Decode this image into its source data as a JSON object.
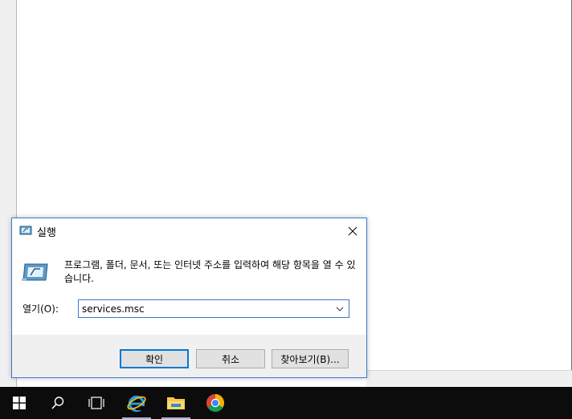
{
  "dialog": {
    "title": "실행",
    "description": "프로그램, 폴더, 문서, 또는 인터넷 주소를 입력하여 해당 항목을 열 수 있습니다.",
    "open_label": "열기(O):",
    "input_value": "services.msc",
    "ok_label": "확인",
    "cancel_label": "취소",
    "browse_label": "찾아보기(B)..."
  },
  "taskbar": {
    "items": [
      "start-icon",
      "search-icon",
      "task-view-icon",
      "internet-explorer-icon",
      "file-explorer-icon",
      "chrome-icon"
    ]
  },
  "colors": {
    "accent": "#0078d7",
    "taskbar": "#0c0c0c",
    "dialog_border": "#3b7dcc"
  }
}
